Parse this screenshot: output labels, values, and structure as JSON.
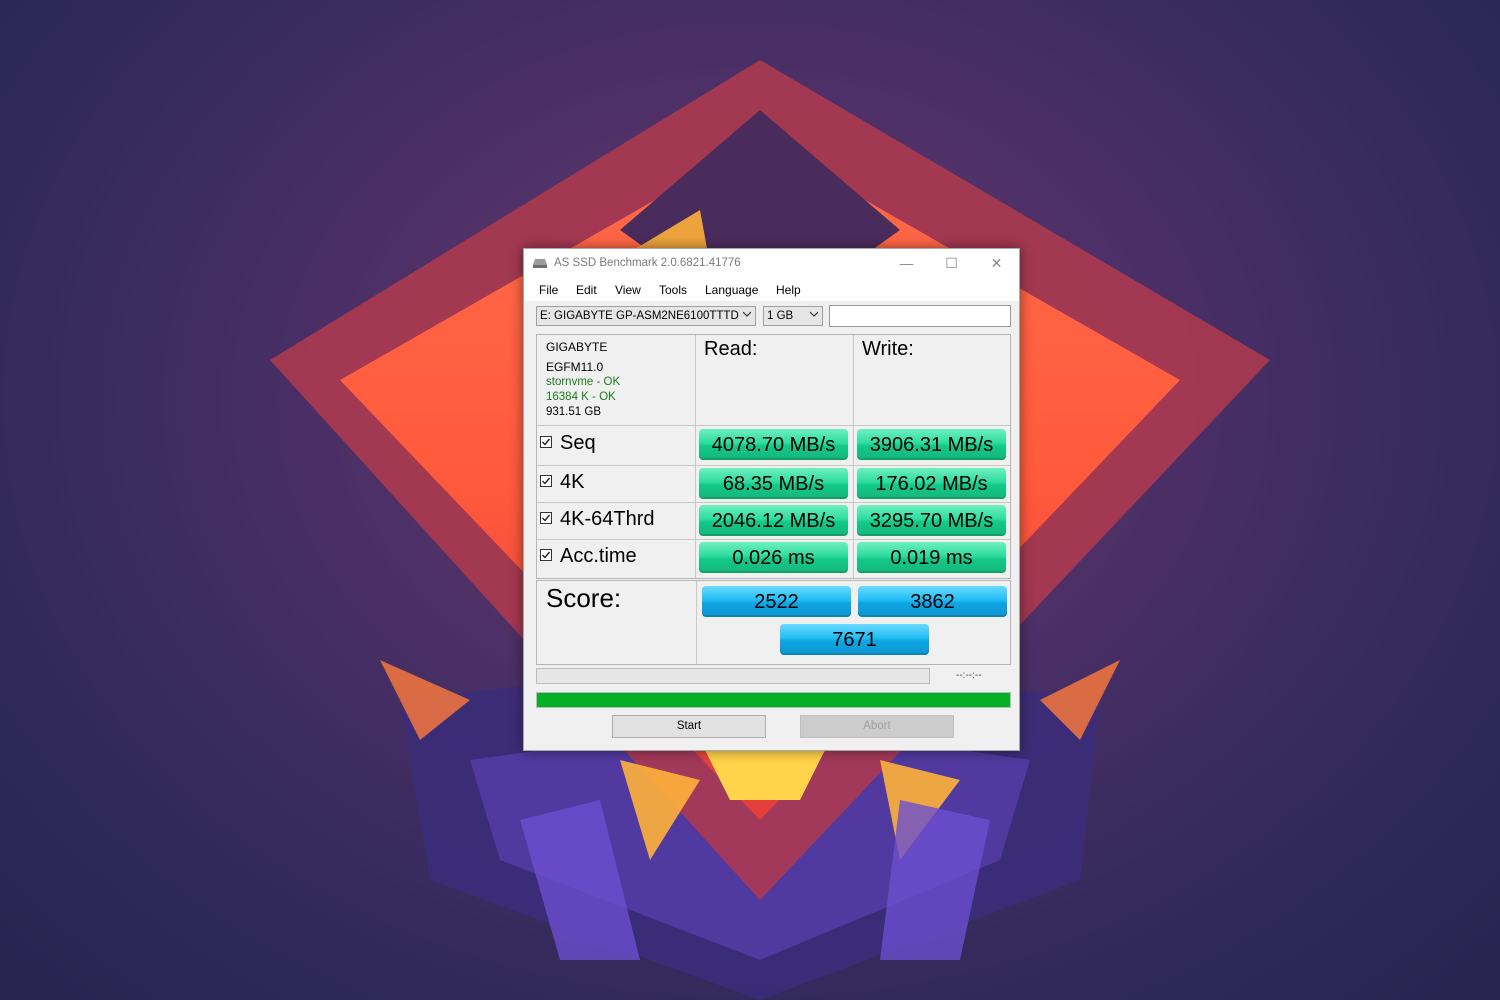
{
  "window": {
    "title": "AS SSD Benchmark 2.0.6821.41776",
    "controls": {
      "minimize": "—",
      "maximize": "☐",
      "close": "✕"
    }
  },
  "menu": [
    "File",
    "Edit",
    "View",
    "Tools",
    "Language",
    "Help"
  ],
  "drive_select": {
    "value": "E: GIGABYTE GP-ASM2NE6100TTTD"
  },
  "size_select": {
    "value": "1 GB"
  },
  "drive_info": {
    "vendor": "GIGABYTE",
    "firmware": "EGFM11.0",
    "driver_status": "stornvme - OK",
    "alignment_status": "16384 K - OK",
    "capacity": "931.51 GB"
  },
  "headers": {
    "read": "Read:",
    "write": "Write:"
  },
  "tests": [
    {
      "name": "Seq",
      "checked": true,
      "read": "4078.70 MB/s",
      "write": "3906.31 MB/s"
    },
    {
      "name": "4K",
      "checked": true,
      "read": "68.35 MB/s",
      "write": "176.02 MB/s"
    },
    {
      "name": "4K-64Thrd",
      "checked": true,
      "read": "2046.12 MB/s",
      "write": "3295.70 MB/s"
    },
    {
      "name": "Acc.time",
      "checked": true,
      "read": "0.026 ms",
      "write": "0.019 ms"
    }
  ],
  "score": {
    "label": "Score:",
    "read": "2522",
    "write": "3862",
    "total": "7671"
  },
  "progress": {
    "time": "--:--:--",
    "fraction": 1.0,
    "color": "#06b025"
  },
  "buttons": {
    "start": "Start",
    "abort": "Abort"
  },
  "colors": {
    "result_green": "#2fdca0",
    "score_blue": "#22bdf2",
    "ok_text": "#1c7a1c"
  }
}
